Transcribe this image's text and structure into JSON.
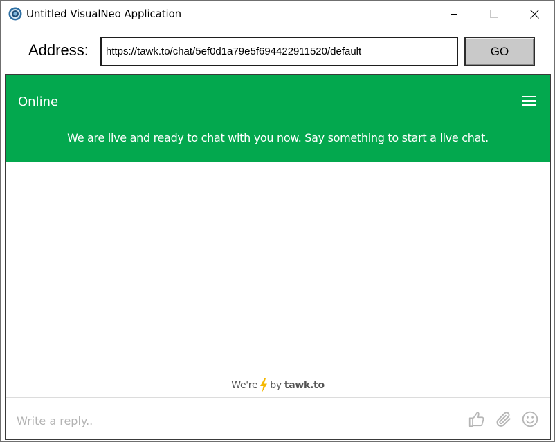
{
  "window": {
    "title": "Untitled VisualNeo Application",
    "controls": {
      "minimize": "minimize",
      "maximize": "maximize",
      "close": "close"
    }
  },
  "address_bar": {
    "label": "Address:",
    "url": "https://tawk.to/chat/5ef0d1a79e5f694422911520/default",
    "go_label": "GO"
  },
  "chat": {
    "status": "Online",
    "welcome_message": "We are live and ready to chat with you now. Say something to start a live chat.",
    "header_color": "#03a84e",
    "powered_by": {
      "prefix": "We're",
      "middle": "by",
      "brand": "tawk.to",
      "bolt_color": "#f5b800"
    },
    "reply_placeholder": "Write a reply..",
    "icons": [
      "menu-icon",
      "thumbs-up-icon",
      "paperclip-icon",
      "smiley-icon"
    ]
  }
}
